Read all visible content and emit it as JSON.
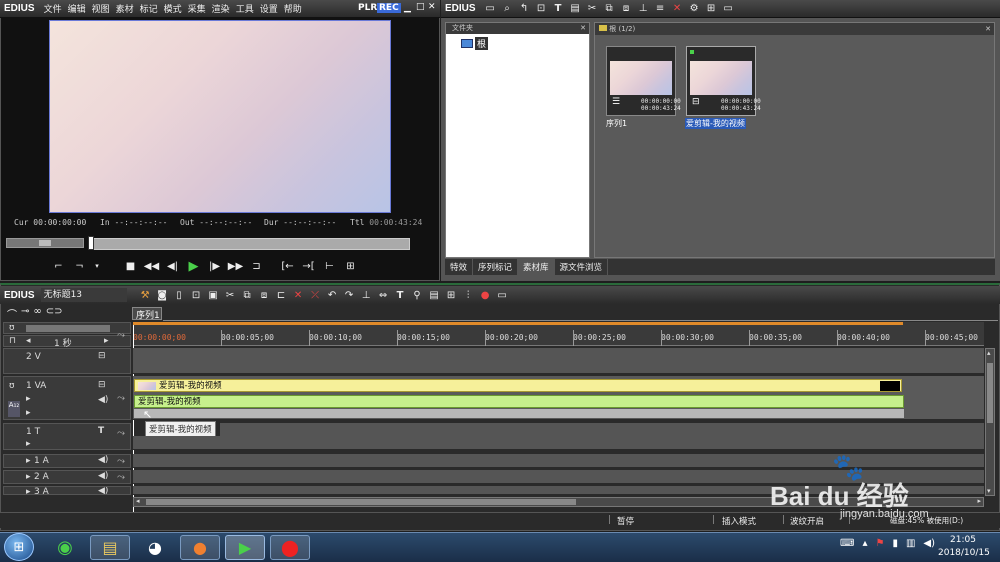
{
  "player": {
    "logo": "EDIUS",
    "menu": [
      "文件",
      "编辑",
      "视图",
      "素材",
      "标记",
      "模式",
      "采集",
      "渲染",
      "工具",
      "设置",
      "帮助"
    ],
    "plr": "PLR",
    "rec": "REC",
    "cur_label": "Cur",
    "cur_value": "00:00:00:00",
    "in_label": "In",
    "in_value": "--:--:--:--",
    "out_label": "Out",
    "out_value": "--:--:--:--",
    "dur_label": "Dur",
    "dur_value": "--:--:--:--",
    "ttl_label": "Ttl",
    "ttl_value": "00:00:43:24"
  },
  "bin": {
    "logo": "EDIUS",
    "folder_header": "文件夹",
    "root_label": "根",
    "path_label": "根 (1/2)",
    "items": [
      {
        "name": "序列1",
        "tc1": "00:00:00:00",
        "tc2": "00:00:43:24",
        "selected": false
      },
      {
        "name": "爱剪辑-我的视频",
        "tc1": "00:00:00:00",
        "tc2": "00:00:43:24",
        "selected": true
      }
    ],
    "tabs": [
      "特效",
      "序列标记",
      "素材库",
      "源文件浏览"
    ]
  },
  "timeline": {
    "logo": "EDIUS",
    "project_name": "无标题13",
    "scale_label": "1 秒",
    "sequence_tab": "序列1",
    "ruler": [
      "00:00:00;00",
      "00:00:05;00",
      "00:00:10;00",
      "00:00:15;00",
      "00:00:20;00",
      "00:00:25;00",
      "00:00:30;00",
      "00:00:35;00",
      "00:00:40;00",
      "00:00:45;00"
    ],
    "tracks": {
      "v2": "2 V",
      "va1": "1 VA",
      "t1": "1 T",
      "a1": "1 A",
      "a2": "2 A",
      "a3": "3 A"
    },
    "video_clip": "爱剪辑-我的视频",
    "audio_clip": "爱剪辑-我的视频",
    "tooltip": "爱剪辑-我的视频"
  },
  "status": {
    "pause": "暂停",
    "insert": "插入模式",
    "ripple": "波纹开启",
    "disk": "磁盘:45% 被使用(D:)"
  },
  "taskbar": {
    "time": "21:05",
    "date": "2018/10/15"
  },
  "watermark": {
    "brand": "Bai du 经验",
    "url": "jingyan.baidu.com"
  },
  "colors": {
    "video_clip": "#f6f09a",
    "audio_clip": "#c6f08c",
    "rec": "#3a6ad8",
    "play_green": "#4ad04a"
  }
}
